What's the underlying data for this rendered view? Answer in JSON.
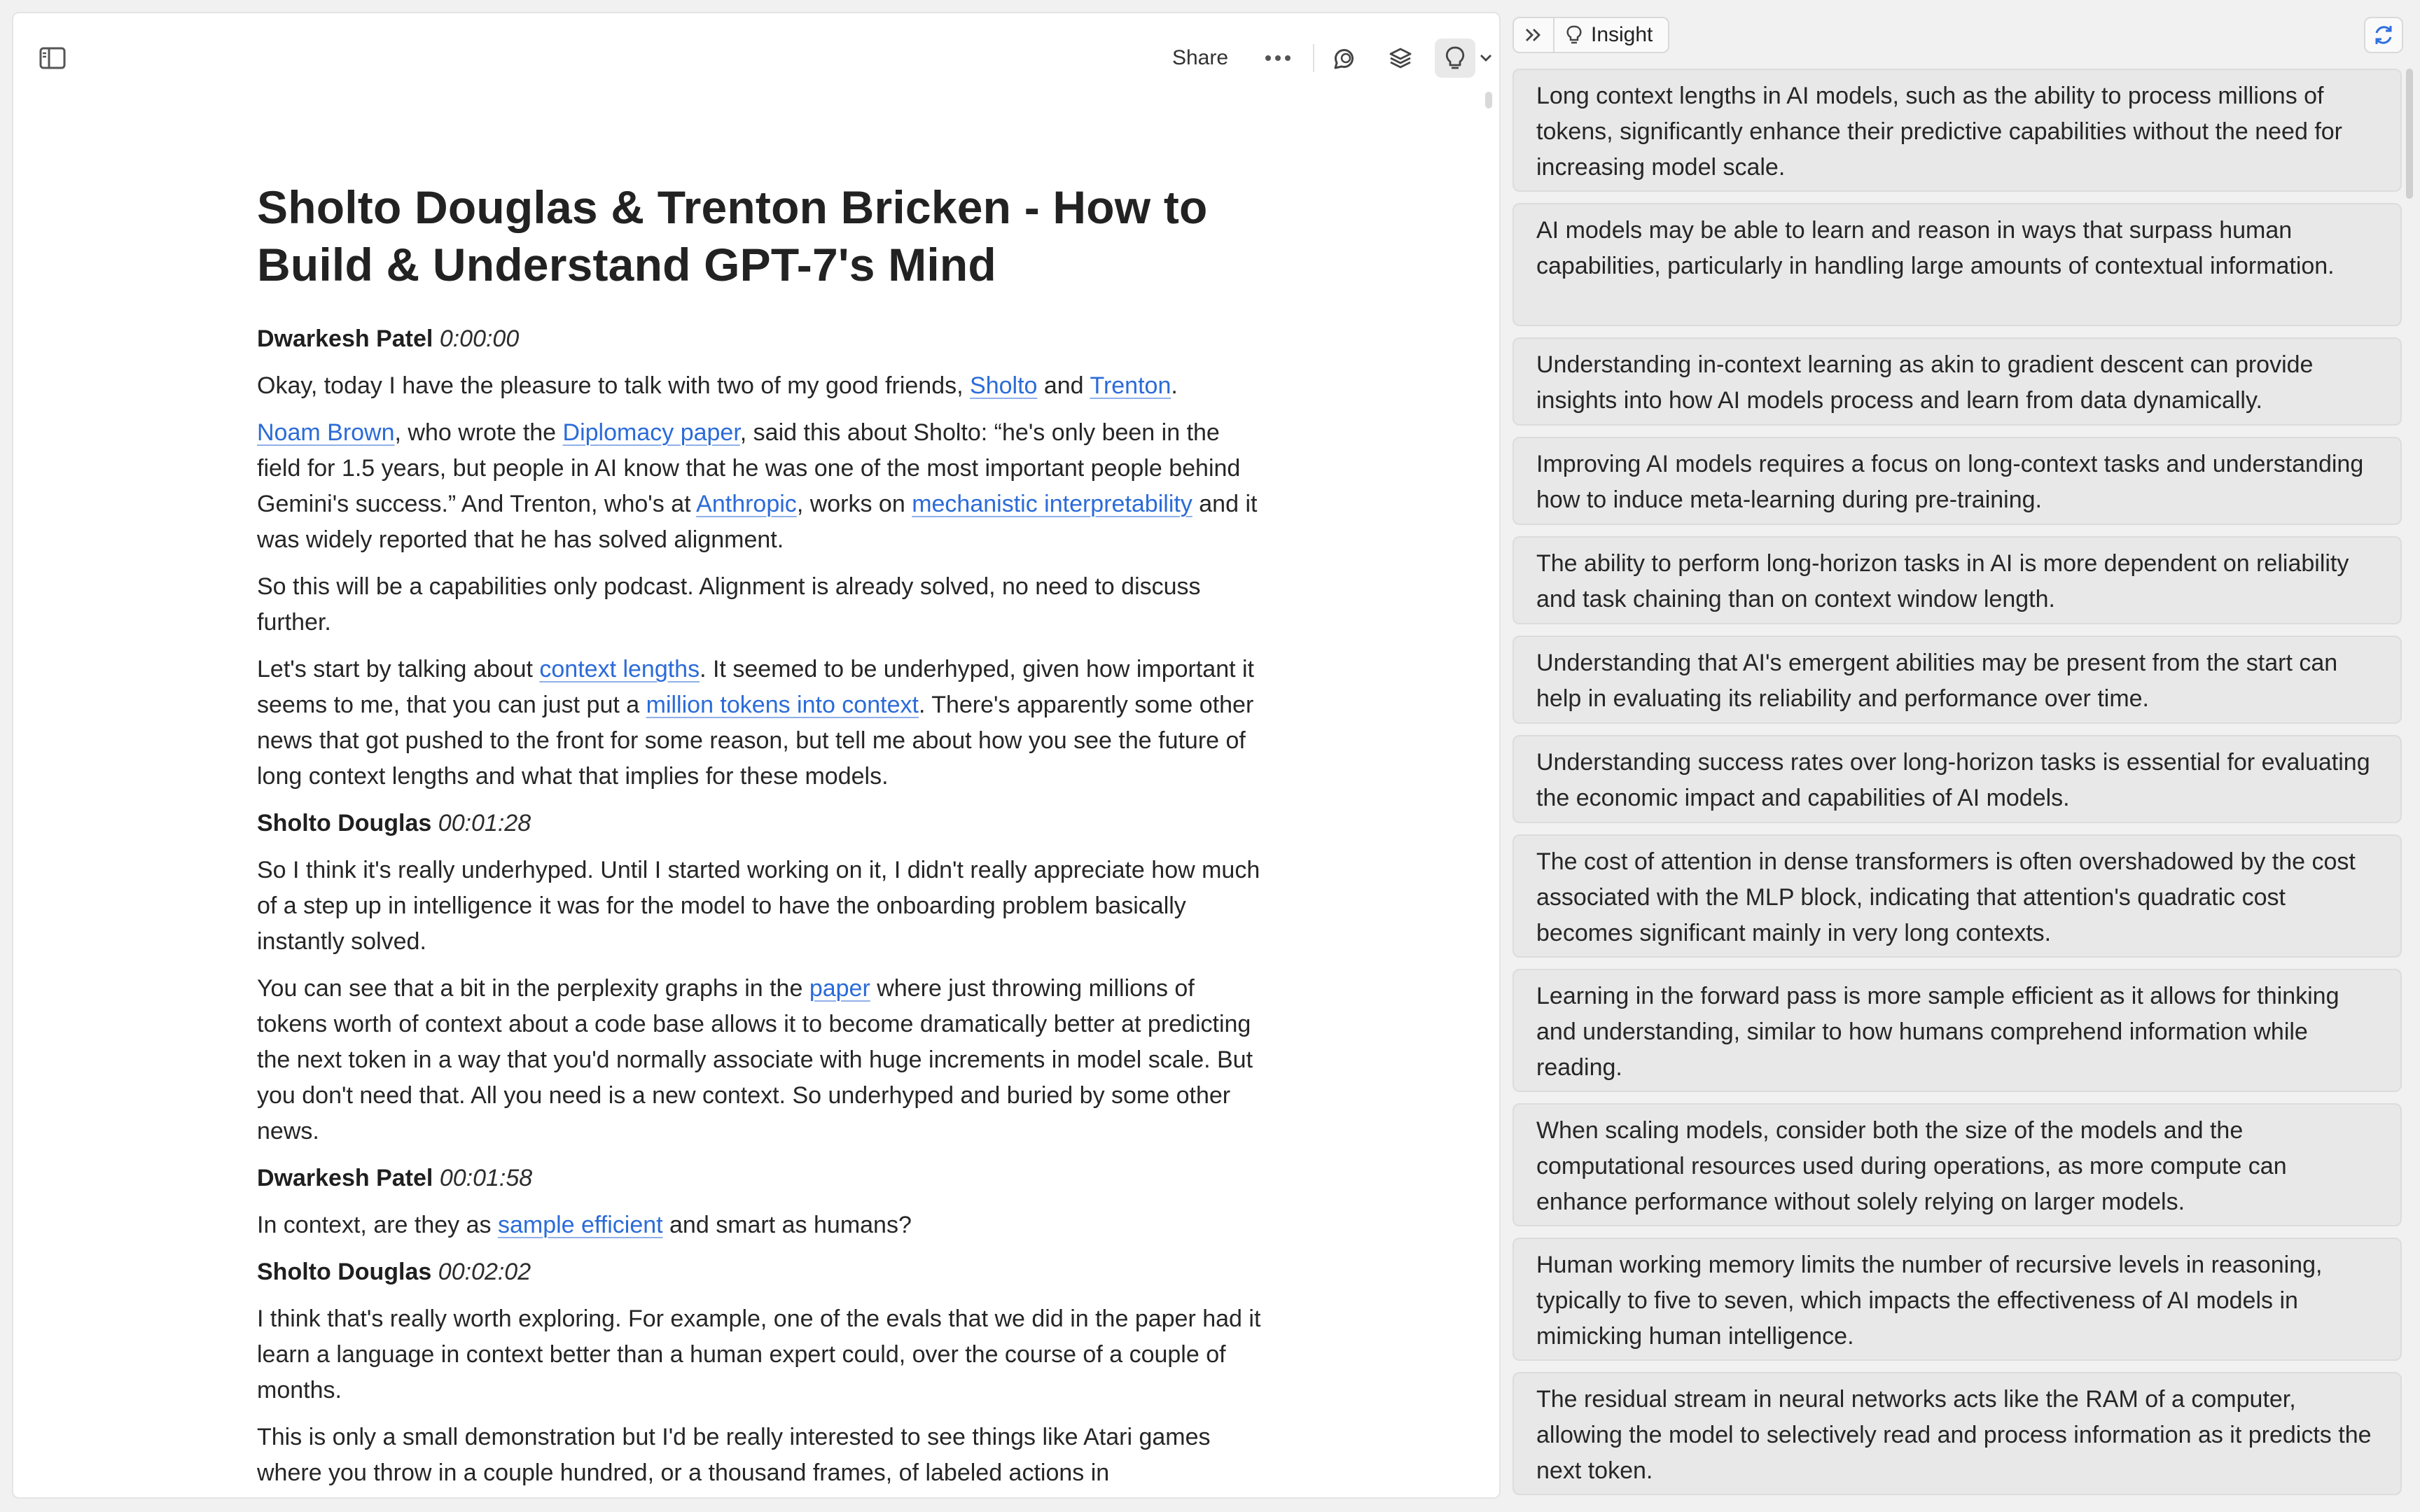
{
  "toolbar": {
    "share_label": "Share",
    "icons": [
      "sidebar-toggle-icon",
      "more-horizontal-icon",
      "chat-bubble-icon",
      "layers-icon",
      "lightbulb-icon",
      "chevron-down-icon"
    ]
  },
  "document": {
    "title": "Sholto Douglas & Trenton Bricken - How to Build & Understand GPT-7's Mind",
    "blocks": {
      "s1": {
        "name": "Dwarkesh Patel",
        "time": "0:00:00"
      },
      "p1": {
        "t1": "Okay, today I have the pleasure to talk with two of my good friends, ",
        "l1": "Sholto",
        "t2": " and ",
        "l2": "Trenton",
        "t3": "."
      },
      "p2": {
        "l1": "Noam Brown",
        "t1": ", who wrote the ",
        "l2": "Diplomacy paper",
        "t2": ", said this about Sholto: “he's only been in the field for 1.5 years, but people in AI know that he was one of the most important people behind Gemini's success.” And Trenton, who's at ",
        "l3": "Anthropic",
        "t3": ", works on ",
        "l4": "mechanistic interpretability",
        "t4": " and it was widely reported that he has solved alignment."
      },
      "p3": {
        "t1": "So this will be a capabilities only podcast. Alignment is already solved, no need to discuss further."
      },
      "p4": {
        "t1": "Let's start by talking about ",
        "l1": "context lengths",
        "t2": ". It seemed to be underhyped, given how important it seems to me, that you can just put a ",
        "l2": "million tokens into context",
        "t3": ". There's apparently some other news that got pushed to the front for some reason, but tell me about how you see the future of long context lengths and what that implies for these models."
      },
      "s2": {
        "name": "Sholto Douglas",
        "time": "00:01:28"
      },
      "p5": {
        "t1": "So I think it's really underhyped. Until I started working on it, I didn't really appreciate how much of a step up in intelligence it was for the model to have the onboarding problem basically instantly solved."
      },
      "p6": {
        "t1": "You can see that a bit in the perplexity graphs in the ",
        "l1": "paper",
        "t2": " where just throwing millions of tokens worth of context about a code base allows it to become dramatically better at predicting the next token in a way that you'd normally associate with huge increments in model scale. But you don't need that. All you need is a new context. So underhyped and buried by some other news."
      },
      "s3": {
        "name": "Dwarkesh Patel",
        "time": "00:01:58"
      },
      "p7": {
        "t1": "In context, are they as ",
        "l1": "sample efficient",
        "t2": " and smart as humans?"
      },
      "s4": {
        "name": "Sholto Douglas",
        "time": "00:02:02"
      },
      "p8": {
        "t1": "I think that's really worth exploring. For example, one of the evals that we did in the paper had it learn a language in context better than a human expert could, over the course of a couple of months."
      },
      "p9": {
        "t1": "This is only a small demonstration but I'd be really interested to see things like Atari games where you throw in a couple hundred, or a thousand frames, of labeled actions in"
      }
    }
  },
  "insight_panel": {
    "tab_label": "Insight",
    "cards": [
      "Long context lengths in AI models, such as the ability to process millions of tokens, significantly enhance their predictive capabilities without the need for increasing model scale.",
      "AI models may be able to learn and reason in ways that surpass human capabilities, particularly in handling large amounts of contextual information.",
      "Understanding in-context learning as akin to gradient descent can provide insights into how AI models process and learn from data dynamically.",
      "Improving AI models requires a focus on long-context tasks and understanding how to induce meta-learning during pre-training.",
      "The ability to perform long-horizon tasks in AI is more dependent on reliability and task chaining than on context window length.",
      "Understanding that AI's emergent abilities may be present from the start can help in evaluating its reliability and performance over time.",
      "Understanding success rates over long-horizon tasks is essential for evaluating the economic impact and capabilities of AI models.",
      "The cost of attention in dense transformers is often overshadowed by the cost associated with the MLP block, indicating that attention's quadratic cost becomes significant mainly in very long contexts.",
      "Learning in the forward pass is more sample efficient as it allows for thinking and understanding, similar to how humans comprehend information while reading.",
      "When scaling models, consider both the size of the models and the computational resources used during operations, as more compute can enhance performance without solely relying on larger models.",
      "Human working memory limits the number of recursive levels in reasoning, typically to five to seven, which impacts the effectiveness of AI models in mimicking human intelligence.",
      "The residual stream in neural networks acts like the RAM of a computer, allowing the model to selectively read and process information as it predicts the next token."
    ]
  },
  "colors": {
    "link": "#2b6bd8",
    "accent": "#2f6fe0",
    "card_bg": "#e8e8e8"
  }
}
